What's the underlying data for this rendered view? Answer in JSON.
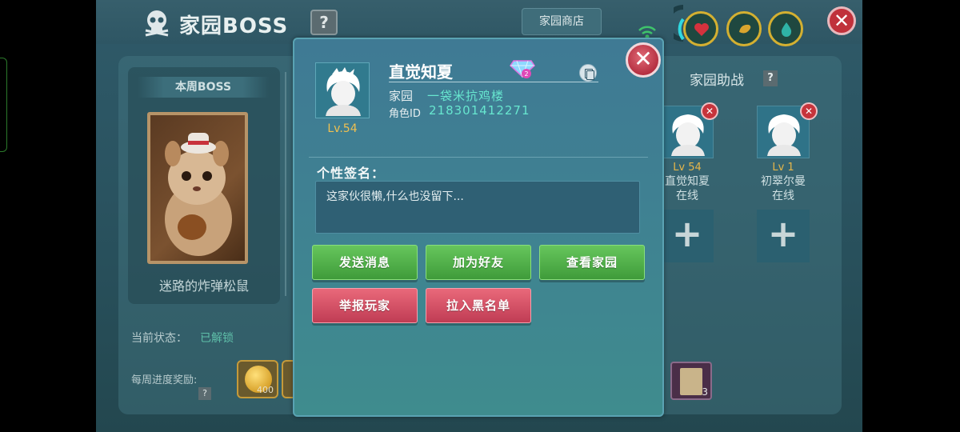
{
  "header": {
    "title": "家园BOSS",
    "help_glyph": "?",
    "shop_tab": "家园商店",
    "close_glyph": "✕",
    "resources": [
      {
        "icon": "heart-icon",
        "color": "#c8323c"
      },
      {
        "icon": "fruit-icon",
        "color": "#d4a32c"
      },
      {
        "icon": "water-drop-icon",
        "color": "#2aa39a"
      }
    ]
  },
  "boss_panel": {
    "header": "本周BOSS",
    "boss_name": "迷路的炸弹松鼠",
    "status_label": "当前状态：",
    "status_value": "已解锁",
    "weekly_label": "每周进度奖励:",
    "weekly_help": "?",
    "rewards": [
      {
        "icon": "gold-coin-icon",
        "amount": "400"
      },
      {
        "icon": "gold-coin-icon",
        "amount": ""
      }
    ],
    "scroll_reward": {
      "icon": "scroll-icon",
      "count": "3"
    }
  },
  "helpers": {
    "title": "家园助战",
    "help_glyph": "?",
    "slots": [
      {
        "level": "Lv 54",
        "name": "直觉知夏",
        "state": "在线"
      },
      {
        "level": "Lv 1",
        "name": "初翠尔曼",
        "state": "在线"
      }
    ],
    "add_glyph": "+",
    "remove_glyph": "✕"
  },
  "modal": {
    "level": "Lv.54",
    "player_name": "直觉知夏",
    "badge_number": "2",
    "home_label": "家园",
    "home_value": "一袋米抗鸡楼",
    "id_label": "角色ID",
    "id_value": "218301412271",
    "signature_label": "个性签名：",
    "signature_text": "这家伙很懒,什么也没留下...",
    "buttons": {
      "send_message": "发送消息",
      "add_friend": "加为好友",
      "view_home": "查看家园",
      "report": "举报玩家",
      "blacklist": "拉入黑名单"
    },
    "close_glyph": "✕"
  }
}
